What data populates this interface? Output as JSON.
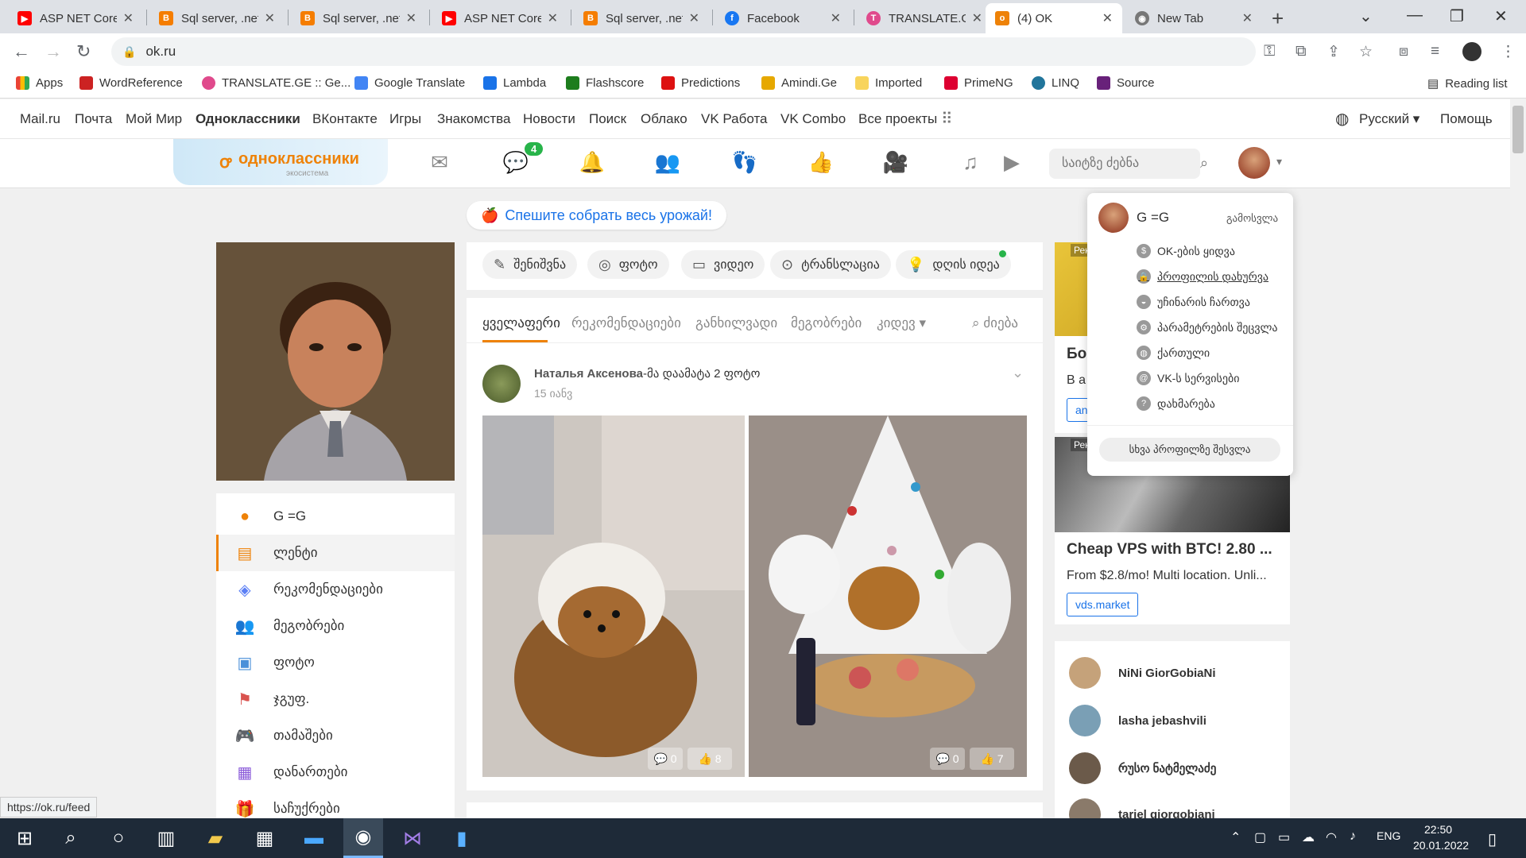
{
  "tabs": [
    {
      "title": "ASP NET Core",
      "icon": "youtube-icon",
      "color": "#ff0000"
    },
    {
      "title": "Sql server, .net",
      "icon": "blogger-icon",
      "color": "#f57d00"
    },
    {
      "title": "Sql server, .net",
      "icon": "blogger-icon",
      "color": "#f57d00"
    },
    {
      "title": "ASP NET Core",
      "icon": "youtube-icon",
      "color": "#ff0000"
    },
    {
      "title": "Sql server, .net",
      "icon": "blogger-icon",
      "color": "#f57d00"
    },
    {
      "title": "Facebook",
      "icon": "facebook-icon",
      "color": "#1877f2"
    },
    {
      "title": "TRANSLATE.GE",
      "icon": "translate-icon",
      "color": "#e04a8c"
    },
    {
      "title": "(4) OK",
      "icon": "ok-icon",
      "color": "#ee8208"
    },
    {
      "title": "New Tab",
      "icon": "chrome-icon",
      "color": "#777777"
    }
  ],
  "address": {
    "url": "ok.ru"
  },
  "bookmarks": [
    {
      "label": "Apps",
      "color": "#4285f4"
    },
    {
      "label": "WordReference",
      "color": "#c22"
    },
    {
      "label": "TRANSLATE.GE :: Ge...",
      "color": "#e04a8c"
    },
    {
      "label": "Google Translate",
      "color": "#4285f4"
    },
    {
      "label": "Lambda",
      "color": "#1a73e8"
    },
    {
      "label": "Flashscore",
      "color": "#1d7d1d"
    },
    {
      "label": "Predictions",
      "color": "#d11"
    },
    {
      "label": "Amindi.Ge",
      "color": "#e6a800"
    },
    {
      "label": "Imported",
      "color": "#f8d45c"
    },
    {
      "label": "PrimeNG",
      "color": "#dd0031"
    },
    {
      "label": "LINQ",
      "color": "#21759b"
    },
    {
      "label": "Source",
      "color": "#68217a"
    }
  ],
  "reading_list": "Reading list",
  "portal": {
    "links": [
      "Mail.ru",
      "Почта",
      "Мой Мир",
      "Одноклассники",
      "ВКонтакте",
      "Игры",
      "Знакомства",
      "Новости",
      "Поиск",
      "Облако",
      "VK Работа",
      "VK Combo",
      "Все проекты"
    ],
    "language": "Русский",
    "help": "Помощь"
  },
  "header": {
    "logo_text": "одноклассники",
    "logo_sub": "экосистема",
    "messages_badge": "4",
    "search_placeholder": "საიტზე ძებნა"
  },
  "promo": "Спешите собрать весь урожай!",
  "left_menu": [
    {
      "label": "G =G",
      "icon": "user-icon",
      "color": "#ee8208"
    },
    {
      "label": "ლენტი",
      "icon": "feed-icon",
      "color": "#ee8208"
    },
    {
      "label": "რეკომენდაციები",
      "icon": "compass-icon",
      "color": "#5b7ff5"
    },
    {
      "label": "მეგობრები",
      "icon": "friends-icon",
      "color": "#f07b5a"
    },
    {
      "label": "ფოტო",
      "icon": "photo-icon",
      "color": "#4a90d9"
    },
    {
      "label": "ჯგუფ.",
      "icon": "groups-icon",
      "color": "#d9534f"
    },
    {
      "label": "თამაშები",
      "icon": "games-icon",
      "color": "#e8545a"
    },
    {
      "label": "დანართები",
      "icon": "apps-icon",
      "color": "#8a5ad9"
    },
    {
      "label": "საჩუქრები",
      "icon": "gift-icon",
      "color": "#4a90d9"
    }
  ],
  "composer": [
    {
      "label": "შენიშვნა",
      "icon": "pencil-icon"
    },
    {
      "label": "ფოტო",
      "icon": "camera-icon"
    },
    {
      "label": "ვიდეო",
      "icon": "video-icon"
    },
    {
      "label": "ტრანსლაცია",
      "icon": "broadcast-icon"
    },
    {
      "label": "დღის იდეა",
      "icon": "bulb-icon"
    }
  ],
  "feed_tabs": [
    "ყველაფერი",
    "რეკომენდაციები",
    "განხილვადი",
    "მეგობრები",
    "კიდევ"
  ],
  "feed_search": "ძიება",
  "post": {
    "author": "Наталья Аксенова",
    "action": "-მა დაამატა 2 ფოტო",
    "date": "15 იანვ",
    "photos": [
      {
        "comments": "0",
        "likes": "8"
      },
      {
        "comments": "0",
        "likes": "7"
      }
    ]
  },
  "ads": [
    {
      "badge": "Рек",
      "title": "Бо",
      "text": "В а",
      "button": "an"
    },
    {
      "badge": "Рек",
      "title": "Cheap VPS with BTC! 2.80 ...",
      "text": "From $2.8/mo! Multi location. Unli...",
      "button": "vds.market"
    }
  ],
  "friends": [
    "NiNi GiorGobiaNi",
    "lasha jebashvili",
    "რუსო ნატმელაძე",
    "tariel giorgobiani"
  ],
  "dropdown": {
    "name": "G =G",
    "logout": "გამოსვლა",
    "items": [
      {
        "label": "OK-ების ყიდვა",
        "icon": "coin-icon"
      },
      {
        "label": "პროფილის დახურვა",
        "icon": "lock-icon"
      },
      {
        "label": "უჩინარის ჩართვა",
        "icon": "hat-icon"
      },
      {
        "label": "პარამეტრების შეცვლა",
        "icon": "gear-icon"
      },
      {
        "label": "ქართული",
        "icon": "globe-icon"
      },
      {
        "label": "VK-ს სერვისები",
        "icon": "at-icon"
      },
      {
        "label": "დახმარება",
        "icon": "help-icon"
      }
    ],
    "switch_profile": "სხვა პროფილზე შესვლა"
  },
  "status_url": "https://ok.ru/feed",
  "taskbar": {
    "lang": "ENG",
    "time": "22:50",
    "date": "20.01.2022"
  }
}
